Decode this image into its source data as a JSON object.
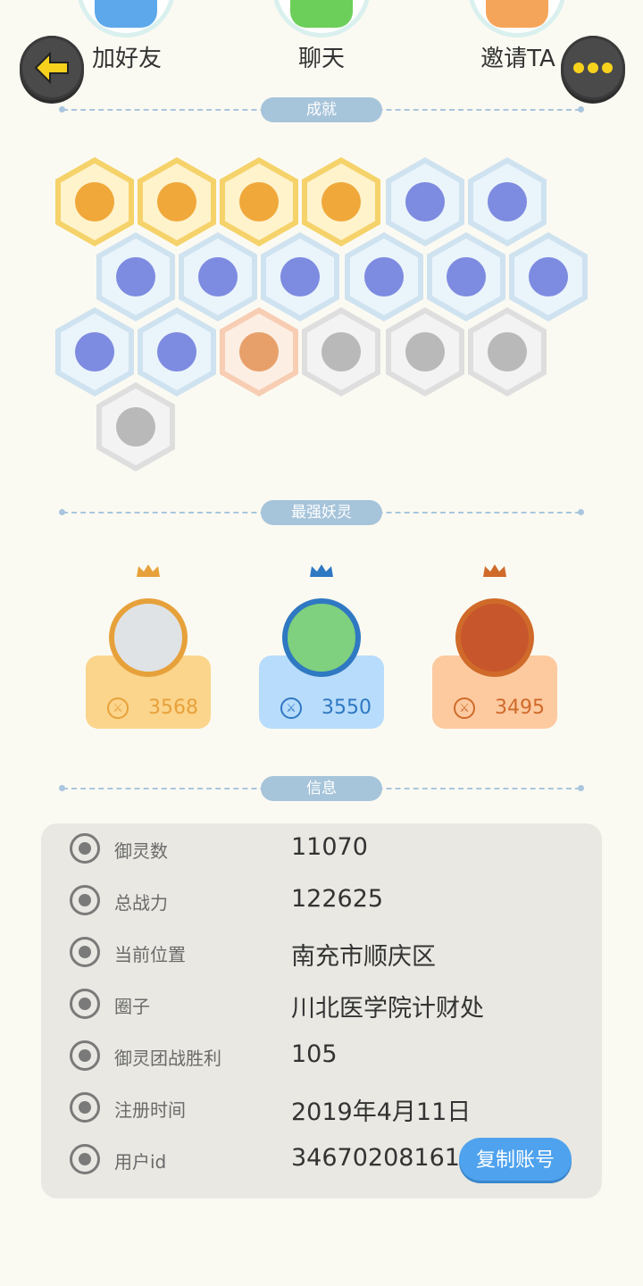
{
  "actions": {
    "add_friend": "加好友",
    "chat": "聊天",
    "invite": "邀请TA"
  },
  "sections": {
    "achievements": "成就",
    "strongest": "最强妖灵",
    "info": "信息"
  },
  "badges": [
    {
      "icon": "fox-face-badge",
      "tier": "gold"
    },
    {
      "icon": "moon-sun-badge",
      "tier": "gold"
    },
    {
      "icon": "golden-orb-badge",
      "tier": "gold"
    },
    {
      "icon": "yin-yang-box-badge",
      "tier": "gold"
    },
    {
      "icon": "sneaker-badge",
      "tier": "blue"
    },
    {
      "icon": "vortex-key-badge",
      "tier": "blue"
    },
    {
      "icon": "crystal-badge",
      "tier": "blue"
    },
    {
      "icon": "yin-yang-wave-badge",
      "tier": "blue"
    },
    {
      "icon": "spirit-figure-badge",
      "tier": "blue"
    },
    {
      "icon": "cat-cart-badge",
      "tier": "blue"
    },
    {
      "icon": "cat-balloon-badge",
      "tier": "blue"
    },
    {
      "icon": "koi-fish-badge",
      "tier": "blue"
    },
    {
      "icon": "vortex-shield-badge",
      "tier": "blue"
    },
    {
      "icon": "monster-statue-badge",
      "tier": "blue"
    },
    {
      "icon": "cat-duo-badge",
      "tier": "peach"
    },
    {
      "icon": "wolf-book-badge",
      "tier": "gray"
    },
    {
      "icon": "no1-badge",
      "tier": "gray"
    },
    {
      "icon": "winged-emblem-badge",
      "tier": "gray"
    },
    {
      "icon": "crossed-swords-badge",
      "tier": "gray"
    }
  ],
  "top_spirits": [
    {
      "score": "3568",
      "color": "#fcd58c",
      "accent": "#e7a13a",
      "avatar_color": "#dfe3e6"
    },
    {
      "score": "3550",
      "color": "#b8dcfb",
      "accent": "#2f78c2",
      "avatar_color": "#7fd07f"
    },
    {
      "score": "3495",
      "color": "#fdcaa0",
      "accent": "#d06a2a",
      "avatar_color": "#c7562c"
    }
  ],
  "info": {
    "rows": [
      {
        "label": "御灵数",
        "value": "11070",
        "icon": "spirit-count-icon"
      },
      {
        "label": "总战力",
        "value": "122625",
        "icon": "sword-power-icon"
      },
      {
        "label": "当前位置",
        "value": "南充市顺庆区",
        "icon": "location-pin-icon"
      },
      {
        "label": "圈子",
        "value": "川北医学院计财处",
        "icon": "circle-target-icon"
      },
      {
        "label": "御灵团战胜利",
        "value": "105",
        "icon": "trophy-figure-icon"
      },
      {
        "label": "注册时间",
        "value": "2019年4月11日",
        "icon": "clock-icon"
      },
      {
        "label": "用户id",
        "value": "34670208161",
        "icon": "id-card-icon"
      }
    ],
    "copy_button": "复制账号"
  }
}
